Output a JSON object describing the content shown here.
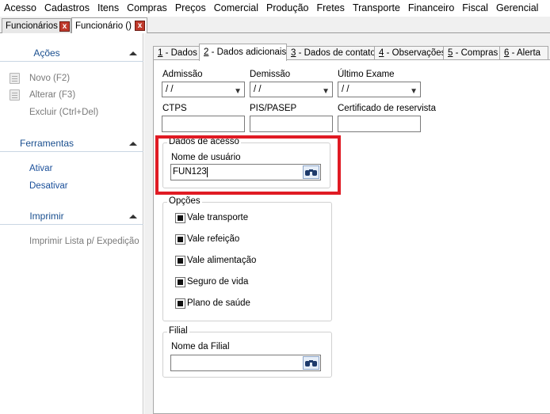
{
  "menu": [
    "Acesso",
    "Cadastros",
    "Itens",
    "Compras",
    "Preços",
    "Comercial",
    "Produção",
    "Fretes",
    "Transporte",
    "Financeiro",
    "Fiscal",
    "Gerencial"
  ],
  "doc_tabs": [
    {
      "label": "Funcionários",
      "close": "x"
    },
    {
      "label": "Funcionário ()",
      "close": "x"
    }
  ],
  "sidebar": {
    "acoes": {
      "title": "Ações",
      "items": [
        "Novo (F2)",
        "Alterar (F3)",
        "Excluir (Ctrl+Del)"
      ]
    },
    "ferramentas": {
      "title": "Ferramentas",
      "items": [
        "Ativar",
        "Desativar"
      ]
    },
    "imprimir": {
      "title": "Imprimir",
      "items": [
        "Imprimir Lista p/ Expedição"
      ]
    }
  },
  "tabs": [
    {
      "key": "1",
      "label": " - Dados"
    },
    {
      "key": "2",
      "label": " - Dados adicionais"
    },
    {
      "key": "3",
      "label": " - Dados de contato"
    },
    {
      "key": "4",
      "label": " - Observações"
    },
    {
      "key": "5",
      "label": " - Compras"
    },
    {
      "key": "6",
      "label": " - Alerta"
    }
  ],
  "form": {
    "admissao": {
      "label": "Admissão",
      "value": " / /"
    },
    "demissao": {
      "label": "Demissão",
      "value": " / /"
    },
    "ultimo_exame": {
      "label": "Último Exame",
      "value": " / /"
    },
    "ctps": {
      "label": "CTPS",
      "value": ""
    },
    "pis": {
      "label": "PIS/PASEP",
      "value": ""
    },
    "certificado": {
      "label": "Certificado de reservista",
      "value": ""
    },
    "acesso": {
      "title": "Dados de acesso",
      "usuario_label": "Nome de usuário",
      "usuario_value": "FUN123"
    },
    "opcoes": {
      "title": "Opções",
      "items": [
        {
          "label": "Vale transporte",
          "checked": true
        },
        {
          "label": "Vale refeição",
          "checked": true
        },
        {
          "label": "Vale alimentação",
          "checked": true
        },
        {
          "label": "Seguro de vida",
          "checked": true
        },
        {
          "label": "Plano de saúde",
          "checked": true
        }
      ]
    },
    "filial": {
      "title": "Filial",
      "nome_label": "Nome da Filial",
      "nome_value": ""
    }
  },
  "colors": {
    "highlight": "#e01b24",
    "link": "#1a4f9a",
    "header": "#1a4f8f"
  }
}
